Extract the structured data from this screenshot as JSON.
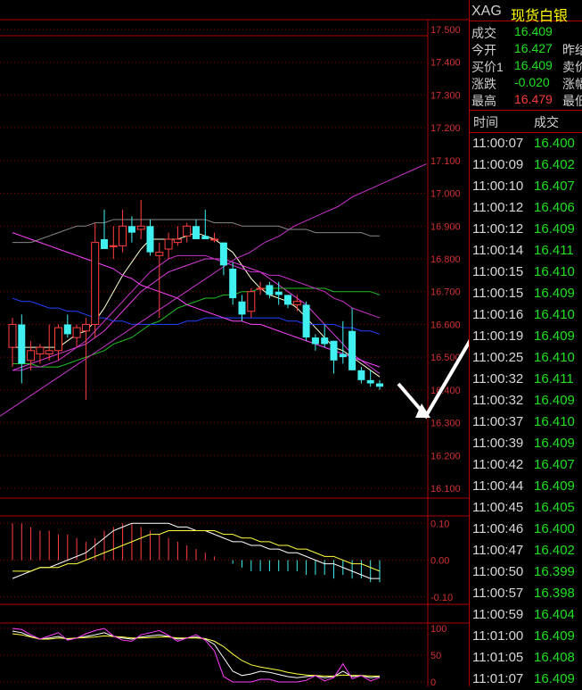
{
  "symbol": {
    "code": "XAG",
    "name": "现货白银"
  },
  "quote": [
    {
      "label": "成交",
      "value": "16.409",
      "color": "green",
      "extra": ""
    },
    {
      "label": "今开",
      "value": "16.427",
      "color": "green",
      "extra": "昨结"
    },
    {
      "label": "买价1",
      "value": "16.409",
      "color": "green",
      "extra": "卖价"
    },
    {
      "label": "涨跌",
      "value": "-0.020",
      "color": "green",
      "extra": "涨幅"
    },
    {
      "label": "最高",
      "value": "16.479",
      "color": "red",
      "extra": "最低"
    }
  ],
  "ticks_header": {
    "time": "时间",
    "price": "成交"
  },
  "ticks": [
    {
      "time": "11:00:07",
      "price": "16.400"
    },
    {
      "time": "11:00:09",
      "price": "16.402"
    },
    {
      "time": "11:00:10",
      "price": "16.407"
    },
    {
      "time": "11:00:12",
      "price": "16.406"
    },
    {
      "time": "11:00:12",
      "price": "16.409"
    },
    {
      "time": "11:00:14",
      "price": "16.411"
    },
    {
      "time": "11:00:15",
      "price": "16.410"
    },
    {
      "time": "11:00:15",
      "price": "16.409"
    },
    {
      "time": "11:00:16",
      "price": "16.410"
    },
    {
      "time": "11:00:19",
      "price": "16.409"
    },
    {
      "time": "11:00:25",
      "price": "16.410"
    },
    {
      "time": "11:00:32",
      "price": "16.411"
    },
    {
      "time": "11:00:32",
      "price": "16.409"
    },
    {
      "time": "11:00:37",
      "price": "16.410"
    },
    {
      "time": "11:00:39",
      "price": "16.409"
    },
    {
      "time": "11:00:42",
      "price": "16.407"
    },
    {
      "time": "11:00:44",
      "price": "16.409"
    },
    {
      "time": "11:00:45",
      "price": "16.405"
    },
    {
      "time": "11:00:46",
      "price": "16.400"
    },
    {
      "time": "11:00:47",
      "price": "16.402"
    },
    {
      "time": "11:00:50",
      "price": "16.399"
    },
    {
      "time": "11:00:57",
      "price": "16.398"
    },
    {
      "time": "11:00:59",
      "price": "16.404"
    },
    {
      "time": "11:01:00",
      "price": "16.409"
    },
    {
      "time": "11:01:05",
      "price": "16.408"
    },
    {
      "time": "11:01:07",
      "price": "16.409"
    }
  ],
  "chart_data": {
    "type": "candlestick",
    "price_axis": {
      "labels": [
        "17.500",
        "17.400",
        "17.300",
        "17.200",
        "17.100",
        "17.000",
        "16.900",
        "16.800",
        "16.700",
        "16.600",
        "16.500",
        "16.400",
        "16.300",
        "16.200",
        "16.100"
      ],
      "ylim": [
        16.07,
        17.53
      ]
    },
    "macd_axis": {
      "labels": [
        "0.10",
        "0.00",
        "-0.10"
      ]
    },
    "kdj_axis": {
      "labels": [
        "100",
        "50",
        "0"
      ]
    },
    "candles": [
      {
        "o": 16.53,
        "h": 16.62,
        "l": 16.47,
        "c": 16.6
      },
      {
        "o": 16.6,
        "h": 16.63,
        "l": 16.42,
        "c": 16.48
      },
      {
        "o": 16.49,
        "h": 16.55,
        "l": 16.46,
        "c": 16.52
      },
      {
        "o": 16.51,
        "h": 16.54,
        "l": 16.48,
        "c": 16.53
      },
      {
        "o": 16.51,
        "h": 16.6,
        "l": 16.49,
        "c": 16.52
      },
      {
        "o": 16.52,
        "h": 16.6,
        "l": 16.49,
        "c": 16.59
      },
      {
        "o": 16.6,
        "h": 16.63,
        "l": 16.56,
        "c": 16.57
      },
      {
        "o": 16.56,
        "h": 16.6,
        "l": 16.53,
        "c": 16.59
      },
      {
        "o": 16.58,
        "h": 16.62,
        "l": 16.37,
        "c": 16.6
      },
      {
        "o": 16.6,
        "h": 16.91,
        "l": 16.56,
        "c": 16.85
      },
      {
        "o": 16.86,
        "h": 16.95,
        "l": 16.83,
        "c": 16.83
      },
      {
        "o": 16.84,
        "h": 16.9,
        "l": 16.8,
        "c": 16.84
      },
      {
        "o": 16.84,
        "h": 16.95,
        "l": 16.82,
        "c": 16.9
      },
      {
        "o": 16.9,
        "h": 16.93,
        "l": 16.85,
        "c": 16.88
      },
      {
        "o": 16.89,
        "h": 16.98,
        "l": 16.86,
        "c": 16.9
      },
      {
        "o": 16.9,
        "h": 16.92,
        "l": 16.81,
        "c": 16.82
      },
      {
        "o": 16.81,
        "h": 16.85,
        "l": 16.62,
        "c": 16.82
      },
      {
        "o": 16.83,
        "h": 16.88,
        "l": 16.8,
        "c": 16.86
      },
      {
        "o": 16.85,
        "h": 16.9,
        "l": 16.84,
        "c": 16.86
      },
      {
        "o": 16.87,
        "h": 16.91,
        "l": 16.85,
        "c": 16.9
      },
      {
        "o": 16.9,
        "h": 16.92,
        "l": 16.86,
        "c": 16.86
      },
      {
        "o": 16.87,
        "h": 16.95,
        "l": 16.86,
        "c": 16.86
      },
      {
        "o": 16.86,
        "h": 16.88,
        "l": 16.85,
        "c": 16.86
      },
      {
        "o": 16.85,
        "h": 16.85,
        "l": 16.75,
        "c": 16.78
      },
      {
        "o": 16.77,
        "h": 16.79,
        "l": 16.66,
        "c": 16.68
      },
      {
        "o": 16.67,
        "h": 16.69,
        "l": 16.61,
        "c": 16.63
      },
      {
        "o": 16.64,
        "h": 16.71,
        "l": 16.62,
        "c": 16.7
      },
      {
        "o": 16.71,
        "h": 16.73,
        "l": 16.69,
        "c": 16.71
      },
      {
        "o": 16.72,
        "h": 16.73,
        "l": 16.68,
        "c": 16.69
      },
      {
        "o": 16.7,
        "h": 16.73,
        "l": 16.66,
        "c": 16.69
      },
      {
        "o": 16.69,
        "h": 16.69,
        "l": 16.65,
        "c": 16.66
      },
      {
        "o": 16.66,
        "h": 16.69,
        "l": 16.64,
        "c": 16.67
      },
      {
        "o": 16.66,
        "h": 16.67,
        "l": 16.55,
        "c": 16.56
      },
      {
        "o": 16.56,
        "h": 16.57,
        "l": 16.52,
        "c": 16.54
      },
      {
        "o": 16.56,
        "h": 16.6,
        "l": 16.53,
        "c": 16.54
      },
      {
        "o": 16.55,
        "h": 16.55,
        "l": 16.45,
        "c": 16.49
      },
      {
        "o": 16.51,
        "h": 16.61,
        "l": 16.48,
        "c": 16.5
      },
      {
        "o": 16.58,
        "h": 16.65,
        "l": 16.46,
        "c": 16.46
      },
      {
        "o": 16.46,
        "h": 16.47,
        "l": 16.42,
        "c": 16.43
      },
      {
        "o": 16.43,
        "h": 16.46,
        "l": 16.41,
        "c": 16.42
      },
      {
        "o": 16.42,
        "h": 16.43,
        "l": 16.4,
        "c": 16.41
      }
    ],
    "series": [
      {
        "values": [
          16.53,
          16.53,
          16.53,
          16.53,
          16.53,
          16.53,
          16.55,
          16.57,
          16.58,
          16.61,
          16.65,
          16.7,
          16.75,
          16.79,
          16.83,
          16.86,
          16.86,
          16.86,
          16.86,
          16.87,
          16.88,
          16.87,
          16.86,
          16.84,
          16.82,
          16.78,
          16.74,
          16.71,
          16.69,
          16.68,
          16.67,
          16.65,
          16.62,
          16.59,
          16.56,
          16.53,
          16.52,
          16.5,
          16.48,
          16.46,
          16.44
        ]
      },
      {
        "values": [
          16.46,
          16.47,
          16.48,
          16.49,
          16.5,
          16.51,
          16.52,
          16.53,
          16.54,
          16.56,
          16.58,
          16.61,
          16.64,
          16.67,
          16.7,
          16.72,
          16.74,
          16.76,
          16.77,
          16.78,
          16.79,
          16.8,
          16.8,
          16.8,
          16.79,
          16.78,
          16.77,
          16.76,
          16.74,
          16.72,
          16.7,
          16.68,
          16.66,
          16.63,
          16.6,
          16.57,
          16.54,
          16.51,
          16.49,
          16.47,
          16.45
        ]
      },
      {
        "values": [
          16.48,
          16.48,
          16.48,
          16.47,
          16.47,
          16.47,
          16.48,
          16.49,
          16.5,
          16.51,
          16.52,
          16.54,
          16.55,
          16.56,
          16.58,
          16.6,
          16.61,
          16.63,
          16.65,
          16.66,
          16.67,
          16.68,
          16.68,
          16.69,
          16.69,
          16.7,
          16.7,
          16.71,
          16.71,
          16.71,
          16.71,
          16.71,
          16.71,
          16.71,
          16.71,
          16.7,
          16.7,
          16.7,
          16.7,
          16.7,
          16.69
        ]
      },
      {
        "values": [
          16.68,
          16.67,
          16.67,
          16.66,
          16.65,
          16.65,
          16.64,
          16.64,
          16.63,
          16.62,
          16.62,
          16.61,
          16.61,
          16.6,
          16.6,
          16.6,
          16.6,
          16.6,
          16.6,
          16.61,
          16.61,
          16.62,
          16.62,
          16.62,
          16.62,
          16.62,
          16.62,
          16.62,
          16.62,
          16.62,
          16.61,
          16.61,
          16.6,
          16.6,
          16.6,
          16.6,
          16.59,
          16.59,
          16.58,
          16.58,
          16.57
        ]
      }
    ],
    "bands": [
      {
        "values": [
          16.88,
          16.87,
          16.86,
          16.85,
          16.84,
          16.83,
          16.82,
          16.81,
          16.8,
          16.79,
          16.78,
          16.77,
          16.75,
          16.74,
          16.72,
          16.71,
          16.7,
          16.69,
          16.68,
          16.66,
          16.65,
          16.64,
          16.63,
          16.62,
          16.61,
          16.61,
          16.6,
          16.6,
          16.59,
          16.58,
          16.57,
          16.56,
          16.55,
          16.54,
          16.53,
          16.52,
          16.51,
          16.5,
          16.49,
          16.48,
          16.47
        ]
      },
      {
        "values": [
          16.32,
          16.35,
          16.38,
          16.41,
          16.44,
          16.47,
          16.5,
          16.53,
          16.56,
          16.59,
          16.62,
          16.65,
          16.68,
          16.71,
          16.74,
          16.77,
          16.8,
          16.82,
          16.85,
          16.87,
          16.9,
          16.92,
          16.94,
          16.96,
          16.99,
          17.01,
          17.03,
          17.05,
          17.07,
          17.09
        ]
      },
      {
        "values": [
          16.85,
          16.85,
          16.85,
          16.86,
          16.87,
          16.88,
          16.89,
          16.9,
          16.9,
          16.91,
          16.91,
          16.92,
          16.92,
          16.92,
          16.92,
          16.92,
          16.92,
          16.92,
          16.92,
          16.92,
          16.92,
          16.92,
          16.91,
          16.91,
          16.91,
          16.9,
          16.9,
          16.9,
          16.9,
          16.9,
          16.89,
          16.89,
          16.89,
          16.88,
          16.88,
          16.88,
          16.88,
          16.88,
          16.88,
          16.87,
          16.87
        ]
      }
    ],
    "purple_band": {
      "values": [
        16.46,
        16.46,
        16.47,
        16.47,
        16.48,
        16.49,
        16.51,
        16.53,
        16.55,
        16.58,
        16.61,
        16.64,
        16.67,
        16.7,
        16.73,
        16.76,
        16.78,
        16.8,
        16.81,
        16.81,
        16.81,
        16.81,
        16.8,
        16.79,
        16.78,
        16.77,
        16.76,
        16.76,
        16.75,
        16.75,
        16.74,
        16.73,
        16.72,
        16.71,
        16.7,
        16.68,
        16.67,
        16.65,
        16.64,
        16.63,
        16.62
      ]
    },
    "macd_hist": [
      0.1,
      0.1,
      0.09,
      0.08,
      0.08,
      0.07,
      0.07,
      0.06,
      0.05,
      0.06,
      0.08,
      0.09,
      0.1,
      0.1,
      0.09,
      0.08,
      0.07,
      0.06,
      0.05,
      0.04,
      0.03,
      0.02,
      0.01,
      0.0,
      -0.01,
      -0.02,
      -0.03,
      -0.03,
      -0.03,
      -0.03,
      -0.03,
      -0.03,
      -0.04,
      -0.04,
      -0.04,
      -0.05,
      -0.04,
      -0.05,
      -0.05,
      -0.06,
      -0.06
    ],
    "macd_dif": [
      -0.05,
      -0.04,
      -0.03,
      -0.02,
      -0.02,
      -0.01,
      0.0,
      0.01,
      0.02,
      0.04,
      0.06,
      0.08,
      0.09,
      0.1,
      0.1,
      0.1,
      0.1,
      0.1,
      0.09,
      0.09,
      0.08,
      0.08,
      0.07,
      0.06,
      0.05,
      0.05,
      0.04,
      0.04,
      0.03,
      0.03,
      0.02,
      0.02,
      0.01,
      0.0,
      -0.01,
      -0.01,
      -0.02,
      -0.03,
      -0.04,
      -0.05,
      -0.05
    ],
    "macd_dea": [
      -0.03,
      -0.03,
      -0.03,
      -0.02,
      -0.02,
      -0.02,
      -0.01,
      -0.01,
      0.0,
      0.01,
      0.02,
      0.03,
      0.04,
      0.05,
      0.06,
      0.07,
      0.07,
      0.08,
      0.08,
      0.08,
      0.08,
      0.08,
      0.08,
      0.07,
      0.07,
      0.06,
      0.06,
      0.05,
      0.05,
      0.04,
      0.04,
      0.03,
      0.03,
      0.02,
      0.01,
      0.01,
      0.0,
      -0.01,
      -0.01,
      -0.02,
      -0.03
    ],
    "kdj_k": [
      95,
      92,
      85,
      80,
      82,
      85,
      80,
      82,
      85,
      88,
      92,
      85,
      82,
      80,
      84,
      86,
      88,
      85,
      80,
      82,
      84,
      80,
      70,
      45,
      20,
      12,
      15,
      20,
      18,
      14,
      10,
      8,
      10,
      12,
      8,
      10,
      20,
      10,
      12,
      8,
      10
    ],
    "kdj_d": [
      90,
      88,
      84,
      80,
      80,
      82,
      81,
      82,
      83,
      84,
      86,
      85,
      84,
      82,
      82,
      83,
      84,
      84,
      82,
      82,
      82,
      81,
      76,
      66,
      52,
      40,
      32,
      28,
      25,
      22,
      18,
      15,
      13,
      12,
      11,
      11,
      13,
      12,
      12,
      11,
      11
    ],
    "kdj_j": [
      100,
      98,
      88,
      80,
      86,
      92,
      78,
      82,
      90,
      96,
      100,
      86,
      78,
      76,
      88,
      92,
      96,
      87,
      76,
      82,
      88,
      78,
      58,
      10,
      0,
      0,
      0,
      5,
      5,
      0,
      0,
      0,
      3,
      12,
      2,
      8,
      34,
      6,
      12,
      2,
      8
    ]
  }
}
